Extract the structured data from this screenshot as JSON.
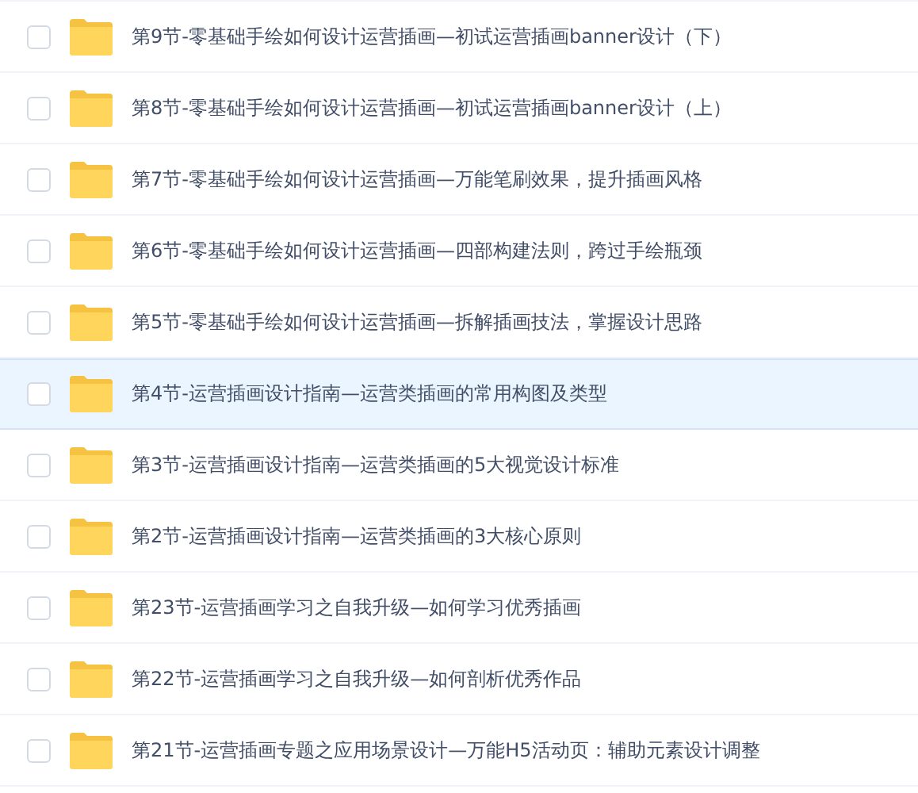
{
  "files": [
    {
      "name": "第9节-零基础手绘如何设计运营插画—初试运营插画banner设计（下）",
      "checked": false,
      "selected": false
    },
    {
      "name": "第8节-零基础手绘如何设计运营插画—初试运营插画banner设计（上）",
      "checked": false,
      "selected": false
    },
    {
      "name": "第7节-零基础手绘如何设计运营插画—万能笔刷效果，提升插画风格",
      "checked": false,
      "selected": false
    },
    {
      "name": "第6节-零基础手绘如何设计运营插画—四部构建法则，跨过手绘瓶颈",
      "checked": false,
      "selected": false
    },
    {
      "name": "第5节-零基础手绘如何设计运营插画—拆解插画技法，掌握设计思路",
      "checked": false,
      "selected": false
    },
    {
      "name": "第4节-运营插画设计指南—运营类插画的常用构图及类型",
      "checked": false,
      "selected": true
    },
    {
      "name": "第3节-运营插画设计指南—运营类插画的5大视觉设计标准",
      "checked": false,
      "selected": false
    },
    {
      "name": "第2节-运营插画设计指南—运营类插画的3大核心原则",
      "checked": false,
      "selected": false
    },
    {
      "name": "第23节-运营插画学习之自我升级—如何学习优秀插画",
      "checked": false,
      "selected": false
    },
    {
      "name": "第22节-运营插画学习之自我升级—如何剖析优秀作品",
      "checked": false,
      "selected": false
    },
    {
      "name": "第21节-运营插画专题之应用场景设计—万能H5活动页：辅助元素设计调整",
      "checked": false,
      "selected": false
    }
  ]
}
